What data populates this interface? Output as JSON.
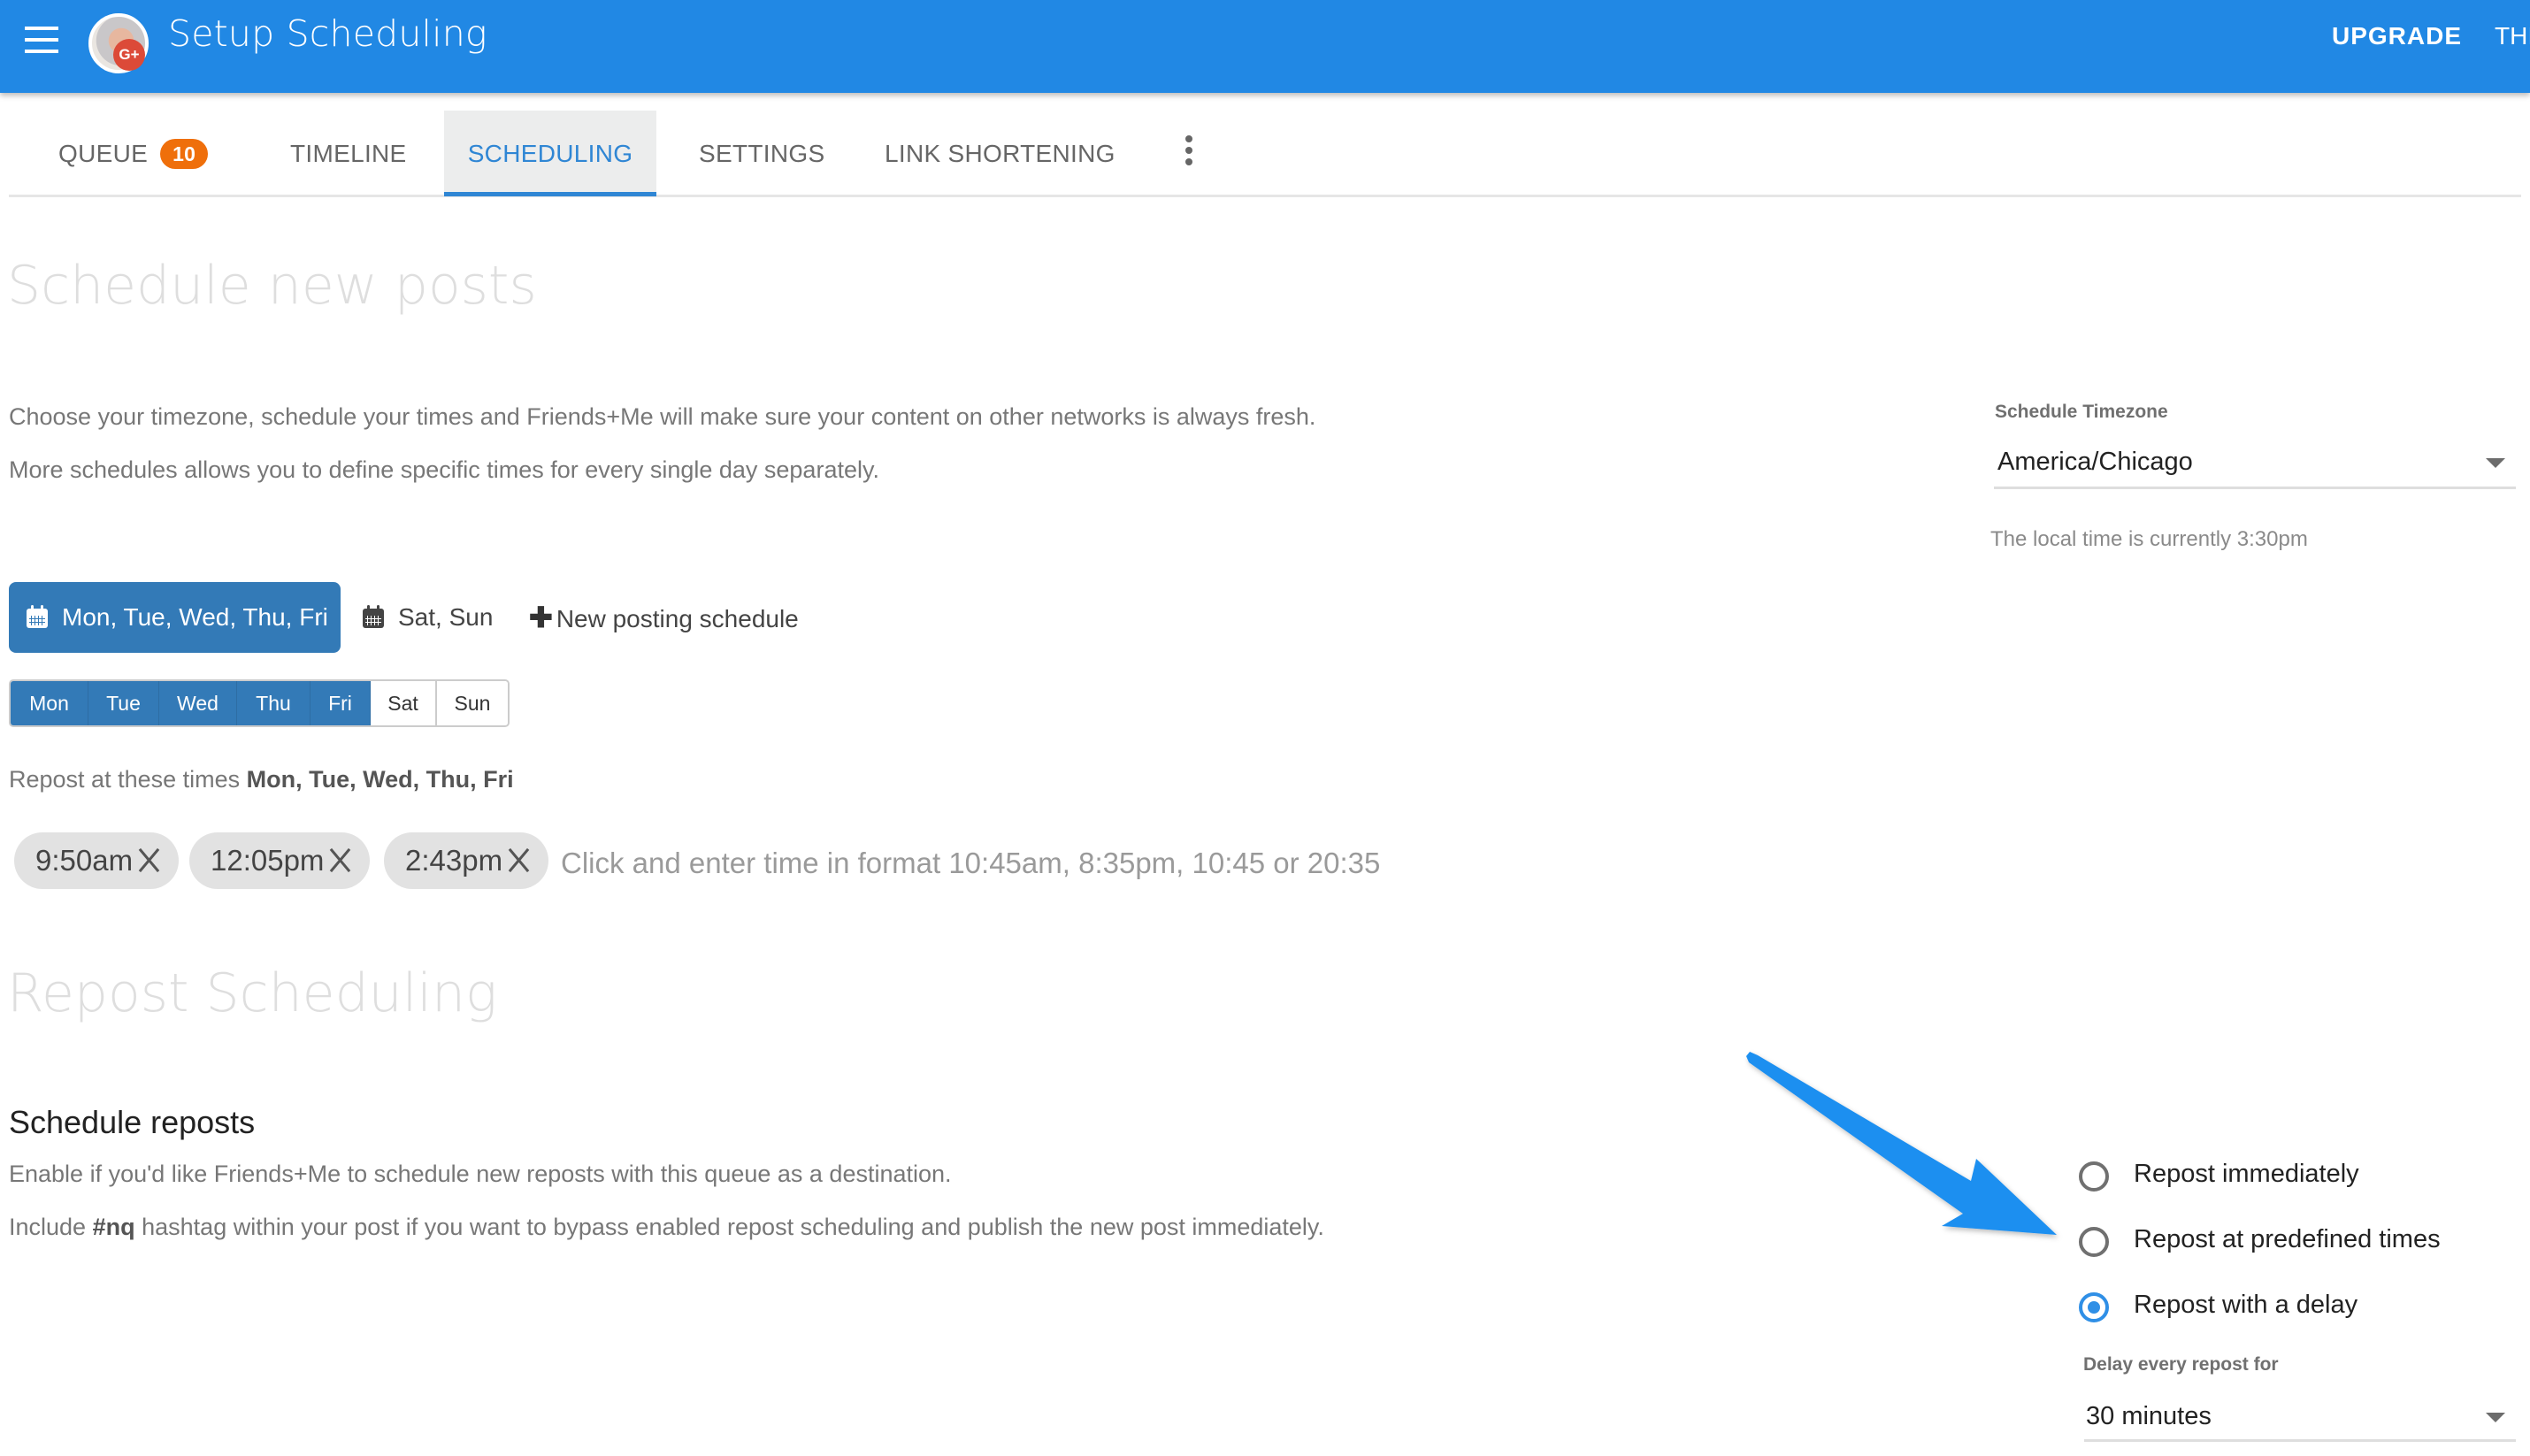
{
  "appbar": {
    "title": "Setup Scheduling",
    "avatar_badge": "G+",
    "upgrade_label": "UPGRADE",
    "theme_label_partial": "THI",
    "color": "#2188e4"
  },
  "tabs": [
    {
      "label": "QUEUE",
      "badge": "10",
      "active": false
    },
    {
      "label": "TIMELINE",
      "active": false
    },
    {
      "label": "SCHEDULING",
      "active": true
    },
    {
      "label": "SETTINGS",
      "active": false
    },
    {
      "label": "LINK SHORTENING",
      "active": false
    }
  ],
  "schedule_new": {
    "heading": "Schedule new posts",
    "desc1": "Choose your timezone, schedule your times and Friends+Me will make sure your content on other networks is always fresh.",
    "desc2": "More schedules allows you to define specific times for every single day separately.",
    "timezone": {
      "label": "Schedule Timezone",
      "value": "America/Chicago",
      "local_time_note": "The local time is currently 3:30pm"
    },
    "schedules": [
      {
        "label": "Mon, Tue, Wed, Thu, Fri",
        "active": true
      },
      {
        "label": "Sat, Sun",
        "active": false
      }
    ],
    "new_schedule_label": "New posting schedule",
    "days": [
      {
        "label": "Mon",
        "selected": true
      },
      {
        "label": "Tue",
        "selected": true
      },
      {
        "label": "Wed",
        "selected": true
      },
      {
        "label": "Thu",
        "selected": true
      },
      {
        "label": "Fri",
        "selected": true
      },
      {
        "label": "Sat",
        "selected": false
      },
      {
        "label": "Sun",
        "selected": false
      }
    ],
    "repost_times_prefix": "Repost at these times",
    "repost_times_days": "Mon, Tue, Wed, Thu, Fri",
    "times": [
      "9:50am",
      "12:05pm",
      "2:43pm"
    ],
    "time_input_placeholder": "Click and enter time in format 10:45am, 8:35pm, 10:45 or 20:35"
  },
  "repost": {
    "heading": "Repost Scheduling",
    "subheading": "Schedule reposts",
    "desc1": "Enable if you'd like Friends+Me to schedule new reposts with this queue as a destination.",
    "desc2_prefix": "Include",
    "desc2_hashtag": "#nq",
    "desc2_suffix": "hashtag within your post if you want to bypass enabled repost scheduling and publish the new post immediately.",
    "options": [
      {
        "label": "Repost immediately",
        "checked": false
      },
      {
        "label": "Repost at predefined times",
        "checked": false
      },
      {
        "label": "Repost with a delay",
        "checked": true
      }
    ],
    "delay_label": "Delay every repost for",
    "delay_value": "30 minutes"
  },
  "annotation": {
    "arrow_color": "#1e8ff0"
  }
}
